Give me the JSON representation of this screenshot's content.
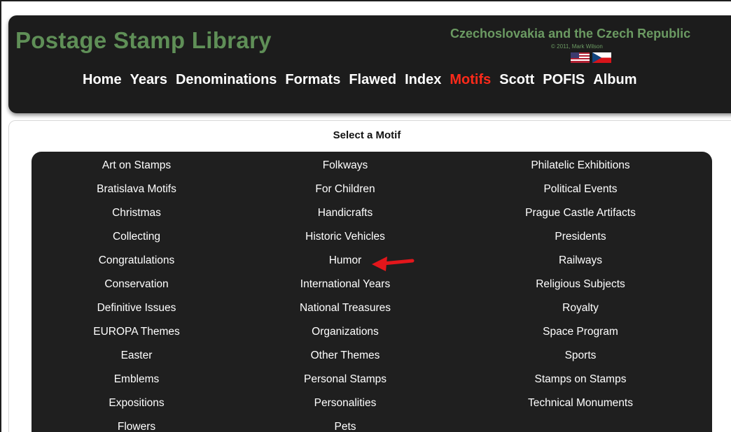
{
  "header": {
    "site_title": "Postage Stamp Library",
    "country_title": "Czechoslovakia and the Czech Republic",
    "copyright": "© 2011, Mark Wilson",
    "flag_icons": [
      "us-flag-icon",
      "czech-flag-icon"
    ]
  },
  "nav": {
    "items": [
      {
        "label": "Home"
      },
      {
        "label": "Years"
      },
      {
        "label": "Denominations"
      },
      {
        "label": "Formats"
      },
      {
        "label": "Flawed"
      },
      {
        "label": "Index"
      },
      {
        "label": "Motifs"
      },
      {
        "label": "Scott"
      },
      {
        "label": "POFIS"
      },
      {
        "label": "Album"
      }
    ],
    "active": "Motifs"
  },
  "main": {
    "heading": "Select a Motif",
    "columns": [
      [
        "Art on Stamps",
        "Bratislava Motifs",
        "Christmas",
        "Collecting",
        "Congratulations",
        "Conservation",
        "Definitive Issues",
        "EUROPA Themes",
        "Easter",
        "Emblems",
        "Expositions",
        "Flowers"
      ],
      [
        "Folkways",
        "For Children",
        "Handicrafts",
        "Historic Vehicles",
        "Humor",
        "International Years",
        "National Treasures",
        "Organizations",
        "Other Themes",
        "Personal Stamps",
        "Personalities",
        "Pets"
      ],
      [
        "Philatelic Exhibitions",
        "Political Events",
        "Prague Castle Artifacts",
        "Presidents",
        "Railways",
        "Religious Subjects",
        "Royalty",
        "Space Program",
        "Sports",
        "Stamps on Stamps",
        "Technical Monuments"
      ]
    ]
  },
  "colors": {
    "title_green": "#5f8f57",
    "active_red": "#ff2a1a",
    "panel_dark": "#1c1c1c",
    "arrow_red": "#e3161b"
  }
}
